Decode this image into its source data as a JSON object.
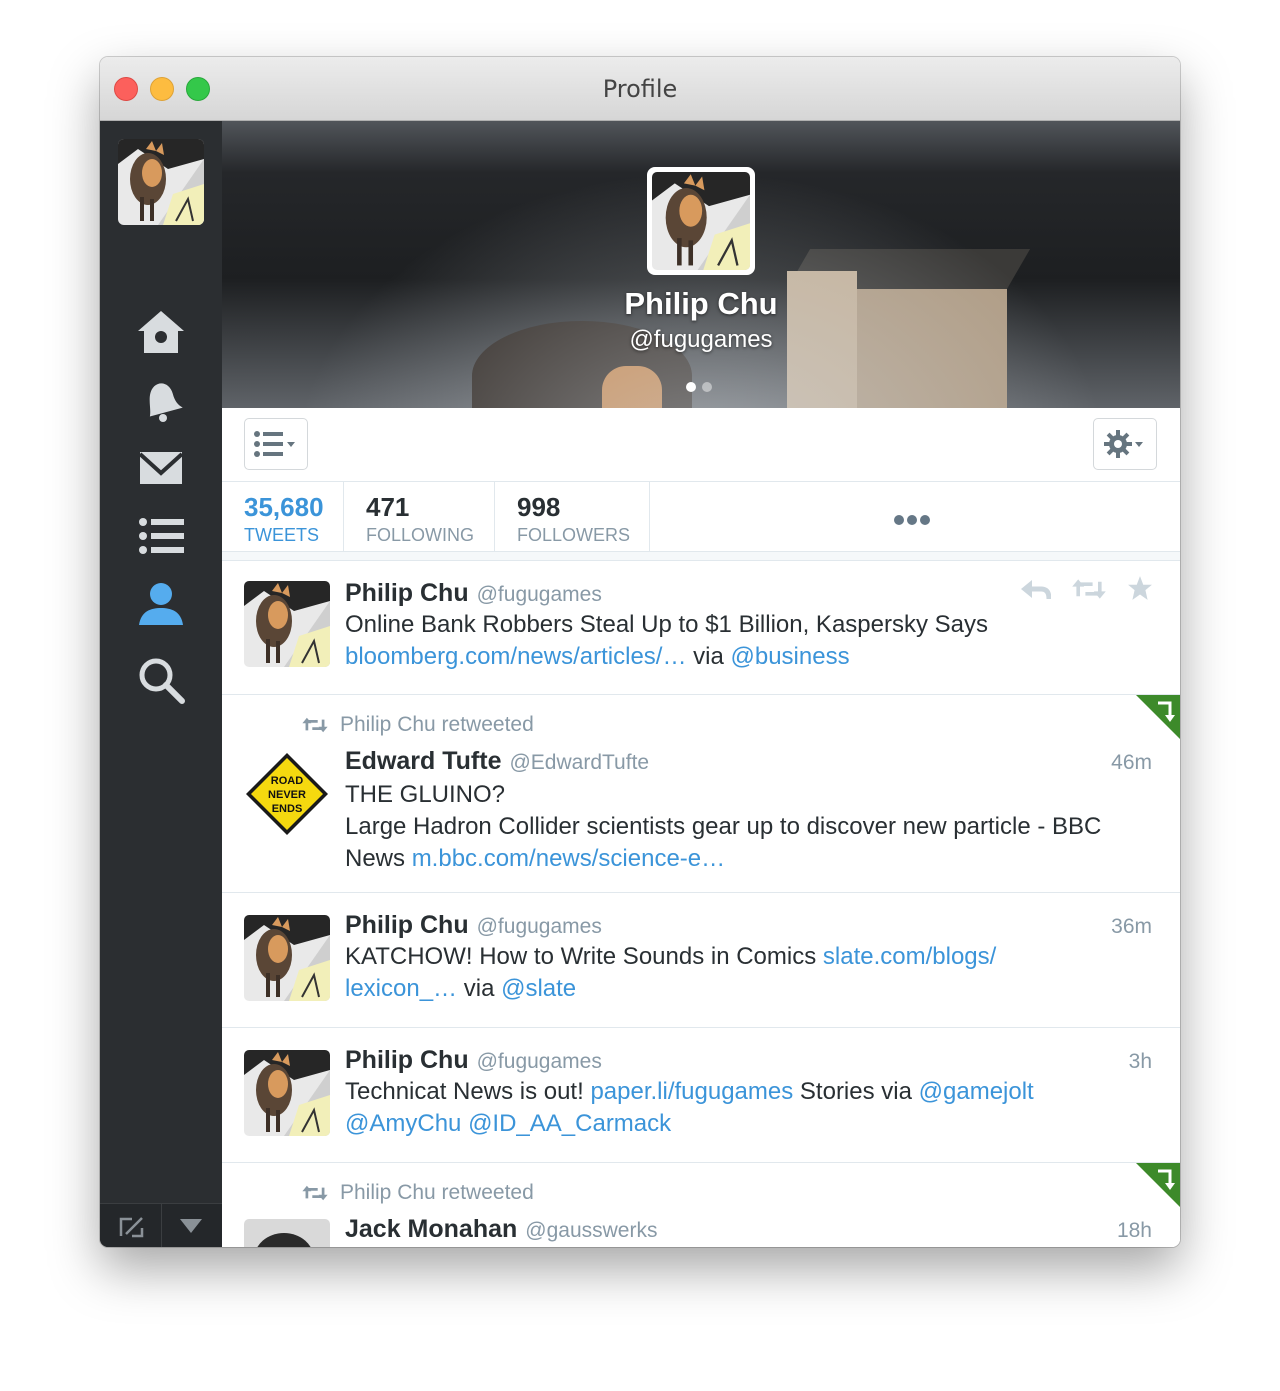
{
  "window": {
    "title": "Profile"
  },
  "profile": {
    "name": "Philip Chu",
    "handle": "@fugugames"
  },
  "stats": [
    {
      "value": "35,680",
      "label": "TWEETS"
    },
    {
      "value": "471",
      "label": "FOLLOWING"
    },
    {
      "value": "998",
      "label": "FOLLOWERS"
    }
  ],
  "sidebar": {
    "items": [
      {
        "icon": "home-icon"
      },
      {
        "icon": "bell-icon"
      },
      {
        "icon": "envelope-icon"
      },
      {
        "icon": "list-icon"
      },
      {
        "icon": "user-icon"
      },
      {
        "icon": "search-icon"
      }
    ]
  },
  "colors": {
    "accent": "#3b94d9",
    "sidebar": "#2b2e31",
    "retweet_corner": "#3d8a2a"
  },
  "tweets": [
    {
      "name": "Philip Chu",
      "handle": "@fugugames",
      "time": "",
      "text1": "Online Bank Robbers Steal Up to $1 Billion, Kaspersky Says",
      "link1": "bloomberg.com/news/articles/…",
      "mid1": " via ",
      "link2": "@business"
    },
    {
      "retweeted_by": "Philip Chu retweeted",
      "name": "Edward Tufte",
      "handle": "@EdwardTufte",
      "time": "46m",
      "line1": "THE GLUINO?",
      "line2": "Large Hadron Collider scientists gear up to discover new particle - BBC",
      "line3": "News ",
      "link1": "m.bbc.com/news/science-e…",
      "avatar_text": [
        "ROAD",
        "NEVER",
        "ENDS"
      ]
    },
    {
      "name": "Philip Chu",
      "handle": "@fugugames",
      "time": "36m",
      "text1": "KATCHOW! How to Write Sounds in Comics ",
      "link1": "slate.com/blogs/",
      "link1b": "lexicon_…",
      "mid1": " via ",
      "link2": "@slate"
    },
    {
      "name": "Philip Chu",
      "handle": "@fugugames",
      "time": "3h",
      "text1": "Technicat News is out! ",
      "link1": "paper.li/fugugames",
      "mid1": " Stories via ",
      "link2": "@gamejolt",
      "link3": "@AmyChu",
      "link4": "@ID_AA_Carmack"
    },
    {
      "retweeted_by": "Philip Chu retweeted",
      "name": "Jack Monahan",
      "handle": "@gausswerks",
      "time": "18h"
    }
  ]
}
